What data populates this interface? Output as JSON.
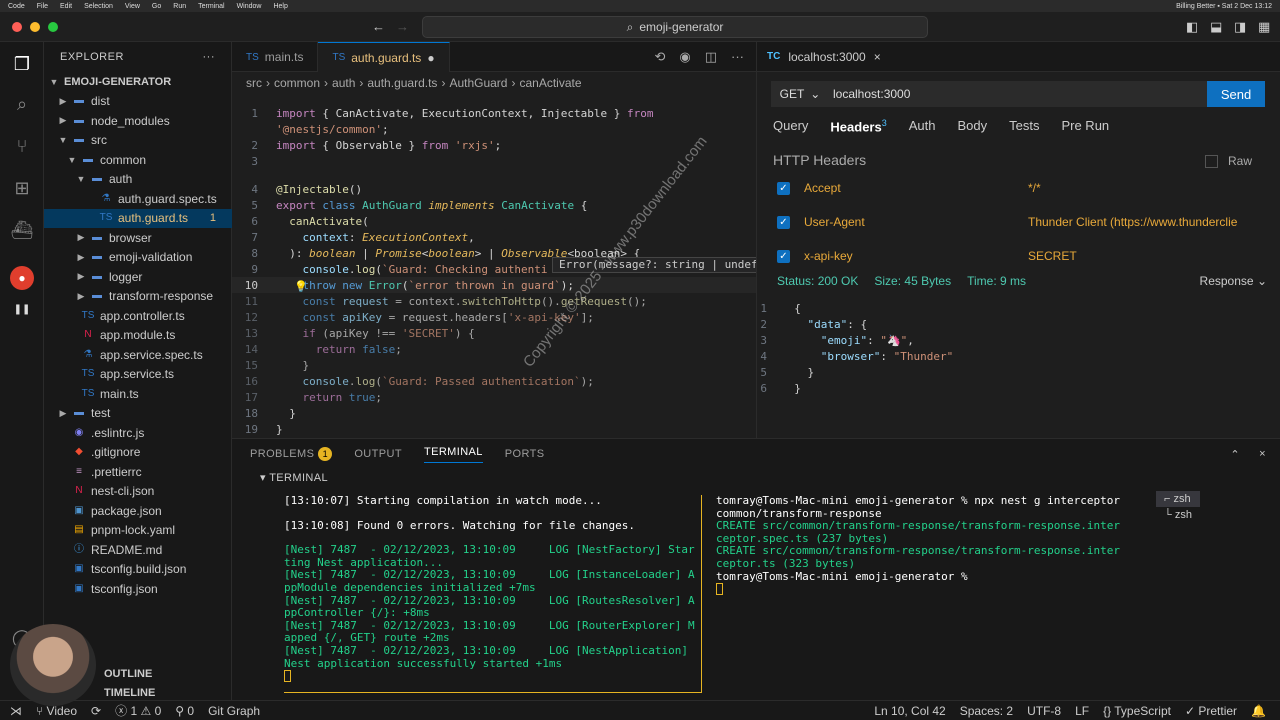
{
  "menubar": {
    "items": [
      "Code",
      "File",
      "Edit",
      "Selection",
      "View",
      "Go",
      "Run",
      "Terminal",
      "Window",
      "Help"
    ],
    "right": "Billing Better  ▪  Sat 2 Dec 13:12"
  },
  "window": {
    "search": "emoji-generator"
  },
  "explorer": {
    "title": "EXPLORER",
    "root": "EMOJI-GENERATOR",
    "items": [
      {
        "label": "dist",
        "depth": 1,
        "kind": "folder",
        "open": false
      },
      {
        "label": "node_modules",
        "depth": 1,
        "kind": "folder",
        "open": false
      },
      {
        "label": "src",
        "depth": 1,
        "kind": "folder",
        "open": true
      },
      {
        "label": "common",
        "depth": 2,
        "kind": "folder",
        "open": true
      },
      {
        "label": "auth",
        "depth": 3,
        "kind": "folder",
        "open": true
      },
      {
        "label": "auth.guard.spec.ts",
        "depth": 4,
        "kind": "ts-spec"
      },
      {
        "label": "auth.guard.ts",
        "depth": 4,
        "kind": "ts",
        "badge": "1",
        "selected": true
      },
      {
        "label": "browser",
        "depth": 3,
        "kind": "folder",
        "open": false
      },
      {
        "label": "emoji-validation",
        "depth": 3,
        "kind": "folder",
        "open": false
      },
      {
        "label": "logger",
        "depth": 3,
        "kind": "folder",
        "open": false
      },
      {
        "label": "transform-response",
        "depth": 3,
        "kind": "folder",
        "open": false
      },
      {
        "label": "app.controller.ts",
        "depth": 2,
        "kind": "ts"
      },
      {
        "label": "app.module.ts",
        "depth": 2,
        "kind": "nest"
      },
      {
        "label": "app.service.spec.ts",
        "depth": 2,
        "kind": "ts-spec"
      },
      {
        "label": "app.service.ts",
        "depth": 2,
        "kind": "ts"
      },
      {
        "label": "main.ts",
        "depth": 2,
        "kind": "ts"
      },
      {
        "label": "test",
        "depth": 1,
        "kind": "folder",
        "open": false
      },
      {
        "label": ".eslintrc.js",
        "depth": 1,
        "kind": "eslint"
      },
      {
        "label": ".gitignore",
        "depth": 1,
        "kind": "git"
      },
      {
        "label": ".prettierrc",
        "depth": 1,
        "kind": "prettier"
      },
      {
        "label": "nest-cli.json",
        "depth": 1,
        "kind": "nest"
      },
      {
        "label": "package.json",
        "depth": 1,
        "kind": "json"
      },
      {
        "label": "pnpm-lock.yaml",
        "depth": 1,
        "kind": "yaml"
      },
      {
        "label": "README.md",
        "depth": 1,
        "kind": "info"
      },
      {
        "label": "tsconfig.build.json",
        "depth": 1,
        "kind": "tsconfig"
      },
      {
        "label": "tsconfig.json",
        "depth": 1,
        "kind": "tsconfig"
      }
    ],
    "outline": "OUTLINE",
    "timeline": "TIMELINE"
  },
  "editor": {
    "tabs": [
      {
        "label": "main.ts"
      },
      {
        "label": "auth.guard.ts",
        "modified": "●"
      }
    ],
    "breadcrumb": [
      "src",
      "common",
      "auth",
      "auth.guard.ts",
      "AuthGuard",
      "canActivate"
    ],
    "hover": {
      "sig": "Error(message?: string | undefined): Error"
    }
  },
  "thunder": {
    "tab": "localhost:3000",
    "tc_label": "TC",
    "method": "GET",
    "url": "localhost:3000",
    "send": "Send",
    "req_tabs": [
      {
        "label": "Query"
      },
      {
        "label": "Headers",
        "count": "3"
      },
      {
        "label": "Auth"
      },
      {
        "label": "Body"
      },
      {
        "label": "Tests"
      },
      {
        "label": "Pre Run"
      }
    ],
    "headers_title": "HTTP Headers",
    "raw": "Raw",
    "headers": [
      {
        "name": "Accept",
        "value": "*/*"
      },
      {
        "name": "User-Agent",
        "value": "Thunder Client (https://www.thunderclie"
      },
      {
        "name": "x-api-key",
        "value": "SECRET"
      }
    ],
    "status": "Status: 200 OK",
    "size": "Size: 45 Bytes",
    "time": "Time: 9 ms",
    "response_label": "Response"
  },
  "panel": {
    "tabs": [
      "PROBLEMS",
      "OUTPUT",
      "TERMINAL",
      "PORTS"
    ],
    "problems_count": "1",
    "terminal_sub": "TERMINAL",
    "left": [
      {
        "cls": "w2",
        "text": "[13:10:07] Starting compilation in watch mode..."
      },
      {
        "cls": "w2",
        "text": ""
      },
      {
        "cls": "w2",
        "text": "[13:10:08] Found 0 errors. Watching for file changes."
      },
      {
        "cls": "w2",
        "text": ""
      },
      {
        "cls": "g2",
        "text": "[Nest] 7487  - 02/12/2023, 13:10:09     LOG [NestFactory] Starting Nest application..."
      },
      {
        "cls": "g2",
        "text": "[Nest] 7487  - 02/12/2023, 13:10:09     LOG [InstanceLoader] AppModule dependencies initialized +7ms"
      },
      {
        "cls": "g2",
        "text": "[Nest] 7487  - 02/12/2023, 13:10:09     LOG [RoutesResolver] AppController {/}: +8ms"
      },
      {
        "cls": "g2",
        "text": "[Nest] 7487  - 02/12/2023, 13:10:09     LOG [RouterExplorer] Mapped {/, GET} route +2ms"
      },
      {
        "cls": "g2",
        "text": "[Nest] 7487  - 02/12/2023, 13:10:09     LOG [NestApplication] Nest application successfully started +1ms"
      }
    ],
    "right": [
      {
        "cls": "w2",
        "text": "tomray@Toms-Mac-mini emoji-generator % npx nest g interceptor common/transform-response"
      },
      {
        "cls": "g2",
        "text": "CREATE src/common/transform-response/transform-response.interceptor.spec.ts (237 bytes)"
      },
      {
        "cls": "g2",
        "text": "CREATE src/common/transform-response/transform-response.interceptor.ts (323 bytes)"
      },
      {
        "cls": "w2",
        "text": "tomray@Toms-Mac-mini emoji-generator % "
      }
    ],
    "shells": [
      "zsh",
      "zsh"
    ]
  },
  "statusbar": {
    "branch": "Video",
    "errors": "1",
    "warnings": "0",
    "ports": "0",
    "git_graph": "Git Graph",
    "position": "Ln 10, Col 42",
    "spaces": "Spaces: 2",
    "encoding": "UTF-8",
    "eol": "LF",
    "language": "TypeScript",
    "formatter": "Prettier"
  },
  "watermark": "Copyright © 2025 - www.p30download.com"
}
